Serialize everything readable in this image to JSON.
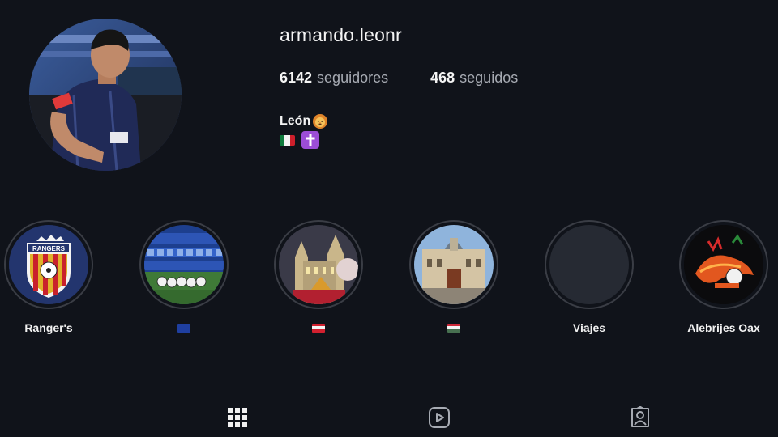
{
  "profile": {
    "username": "armando.leonr",
    "followers_count": "6142",
    "followers_label": "seguidores",
    "following_count": "468",
    "following_label": "seguidos",
    "bio_name": "León",
    "bio_name_emoji": "lion-face",
    "bio_emojis": [
      "mexico-flag",
      "latin-cross"
    ]
  },
  "highlights": [
    {
      "label": "Ranger's",
      "cover": "rangers-crest"
    },
    {
      "label": "",
      "flag": "european-union",
      "cover": "stadium-balls"
    },
    {
      "label": "",
      "flag": "austria",
      "cover": "gothic-city-hall"
    },
    {
      "label": "",
      "flag": "hungary",
      "cover": "budapest-castle"
    },
    {
      "label": "Viajes",
      "cover": "empty"
    },
    {
      "label": "Alebrijes Oax",
      "cover": "alebrijes-crest"
    }
  ],
  "tabs": [
    {
      "name": "posts-grid",
      "icon": "grid-icon",
      "active": true
    },
    {
      "name": "reels",
      "icon": "reels-icon",
      "active": false
    },
    {
      "name": "tagged",
      "icon": "tagged-icon",
      "active": false
    }
  ],
  "colors": {
    "background": "#10131a",
    "muted_text": "#a7abb3",
    "ring": "#3a3d45"
  }
}
